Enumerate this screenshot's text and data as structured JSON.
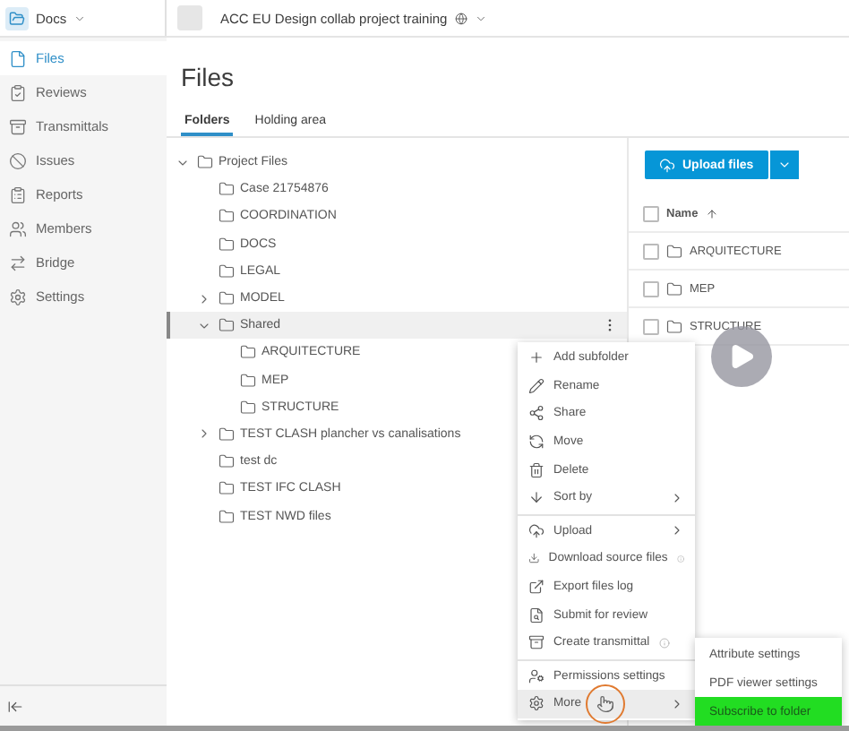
{
  "top_bar": {
    "app_menu": "Docs",
    "project": "ACC EU Design collab project training"
  },
  "sidebar": {
    "items": [
      {
        "label": "Files",
        "selected": true
      },
      {
        "label": "Reviews",
        "selected": false
      },
      {
        "label": "Transmittals",
        "selected": false
      },
      {
        "label": "Issues",
        "selected": false
      },
      {
        "label": "Reports",
        "selected": false
      },
      {
        "label": "Members",
        "selected": false
      },
      {
        "label": "Bridge",
        "selected": false
      },
      {
        "label": "Settings",
        "selected": false
      }
    ]
  },
  "page_title": "Files",
  "tabs": [
    {
      "label": "Folders",
      "selected": true
    },
    {
      "label": "Holding area",
      "selected": false
    }
  ],
  "folder_tree": [
    {
      "name": "Project Files",
      "expanded": true,
      "selected": false,
      "children": [
        {
          "name": "Case 21754876",
          "selected": false
        },
        {
          "name": "COORDINATION",
          "selected": false
        },
        {
          "name": "DOCS",
          "selected": false
        },
        {
          "name": "LEGAL",
          "selected": false
        },
        {
          "name": "MODEL",
          "expanded": false,
          "selected": false
        },
        {
          "name": "Shared",
          "expanded": true,
          "selected": true,
          "children": [
            {
              "name": "ARQUITECTURE",
              "selected": false
            },
            {
              "name": "MEP",
              "selected": false
            },
            {
              "name": "STRUCTURE",
              "selected": false
            }
          ]
        },
        {
          "name": "TEST CLASH plancher vs canalisations",
          "expanded": false,
          "selected": false
        },
        {
          "name": "test dc",
          "selected": false
        },
        {
          "name": "TEST IFC CLASH",
          "selected": false
        },
        {
          "name": "TEST NWD files",
          "selected": false
        }
      ]
    }
  ],
  "upload_button": {
    "label": "Upload files"
  },
  "file_table": {
    "select_all": {
      "checked": false
    },
    "columns": [
      {
        "label": "Name",
        "sort_ascending": true
      }
    ],
    "rows": [
      {
        "name": "ARQUITECTURE",
        "checked": false
      },
      {
        "name": "MEP",
        "checked": false
      },
      {
        "name": "STRUCTURE",
        "checked": false
      }
    ]
  },
  "context_menu": {
    "groups": [
      [
        {
          "label": "Add subfolder",
          "submenu": false,
          "info": false,
          "highlighted": false
        },
        {
          "label": "Rename",
          "submenu": false,
          "info": false,
          "highlighted": false
        },
        {
          "label": "Share",
          "submenu": false,
          "info": false,
          "highlighted": false
        },
        {
          "label": "Move",
          "submenu": false,
          "info": false,
          "highlighted": false
        },
        {
          "label": "Delete",
          "submenu": false,
          "info": false,
          "highlighted": false
        },
        {
          "label": "Sort by",
          "submenu": true,
          "info": false,
          "highlighted": false
        }
      ],
      [
        {
          "label": "Upload",
          "submenu": true,
          "info": false,
          "highlighted": false
        },
        {
          "label": "Download source files",
          "submenu": false,
          "info": true,
          "highlighted": false
        },
        {
          "label": "Export files log",
          "submenu": false,
          "info": false,
          "highlighted": false
        },
        {
          "label": "Submit for review",
          "submenu": false,
          "info": false,
          "highlighted": false
        },
        {
          "label": "Create transmittal",
          "submenu": false,
          "info": true,
          "highlighted": false
        }
      ],
      [
        {
          "label": "Permissions settings",
          "submenu": false,
          "info": false,
          "highlighted": false
        },
        {
          "label": "More",
          "submenu": true,
          "info": false,
          "highlighted": true
        }
      ]
    ]
  },
  "submenu": {
    "items": [
      {
        "label": "Attribute settings",
        "highlighted": false
      },
      {
        "label": "PDF viewer settings",
        "highlighted": false
      },
      {
        "label": "Subscribe to folder",
        "highlighted": true
      }
    ]
  }
}
